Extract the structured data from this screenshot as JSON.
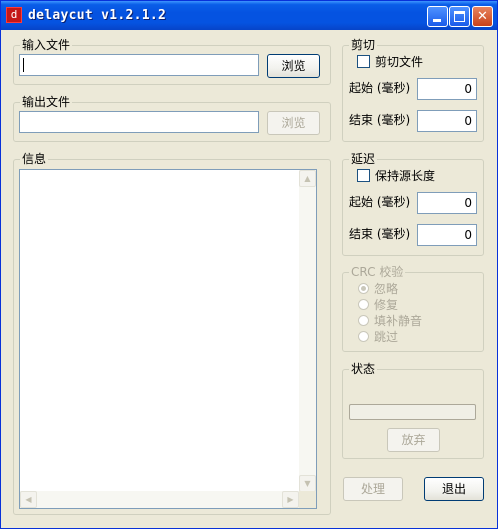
{
  "window": {
    "title": "delaycut v1.2.1.2",
    "icon": "delaycut-app-icon",
    "minimize_glyph": "",
    "maximize_glyph": "",
    "close_glyph": "✕"
  },
  "input_group": {
    "legend": "输入文件",
    "path_value": "",
    "browse_label": "浏览"
  },
  "output_group": {
    "legend": "输出文件",
    "path_value": "",
    "browse_label": "浏览"
  },
  "info_group": {
    "legend": "信息",
    "log_text": "",
    "scroll_up": "▲",
    "scroll_down": "▼",
    "scroll_left": "◀",
    "scroll_right": "▶"
  },
  "cut_group": {
    "legend": "剪切",
    "checkbox_label": "剪切文件",
    "checked": false,
    "start_label": "起始 (毫秒)",
    "start_value": "0",
    "end_label": "结束 (毫秒)",
    "end_value": "0"
  },
  "delay_group": {
    "legend": "延迟",
    "checkbox_label": "保持源长度",
    "checked": false,
    "start_label": "起始 (毫秒)",
    "start_value": "0",
    "end_label": "结束 (毫秒)",
    "end_value": "0"
  },
  "crc_group": {
    "legend": "CRC 校验",
    "options": [
      "忽略",
      "修复",
      "填补静音",
      "跳过"
    ],
    "selected_index": 0
  },
  "status_group": {
    "legend": "状态",
    "progress": 0,
    "abort_label": "放弃"
  },
  "footer": {
    "process_label": "处理",
    "exit_label": "退出"
  },
  "colors": {
    "titlebar": "#0553e1",
    "window_bg": "#ece9d8",
    "disabled_text": "#aca899",
    "field_border": "#7f9db9"
  }
}
